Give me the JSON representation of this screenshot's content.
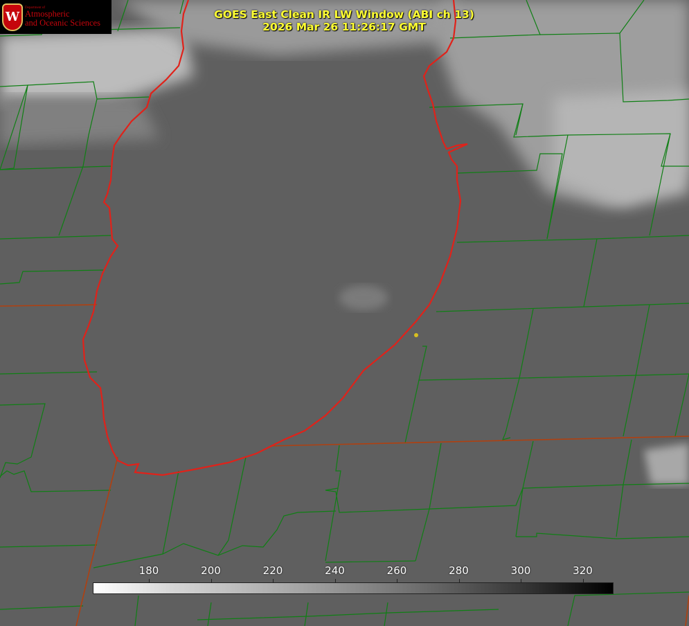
{
  "logo": {
    "department": "Department of",
    "line1": "Atmospheric",
    "line2": "and Oceanic Sciences",
    "seal_letter": "W"
  },
  "header": {
    "title": "GOES East Clean IR LW Window (ABI ch 13)",
    "timestamp": "2026 Mar 26 11:26:17 GMT"
  },
  "colorbar": {
    "ticks": [
      "180",
      "200",
      "220",
      "240",
      "260",
      "280",
      "300",
      "320"
    ],
    "colors": [
      "#ffffff",
      "#000000"
    ]
  },
  "map": {
    "colors": {
      "lake_outline": "#e0221a",
      "county_lines": "#0f7f14",
      "state_lines": "#b04010",
      "station_dot": "#d8c020",
      "cloud_bright": "#c8c8c8"
    }
  }
}
